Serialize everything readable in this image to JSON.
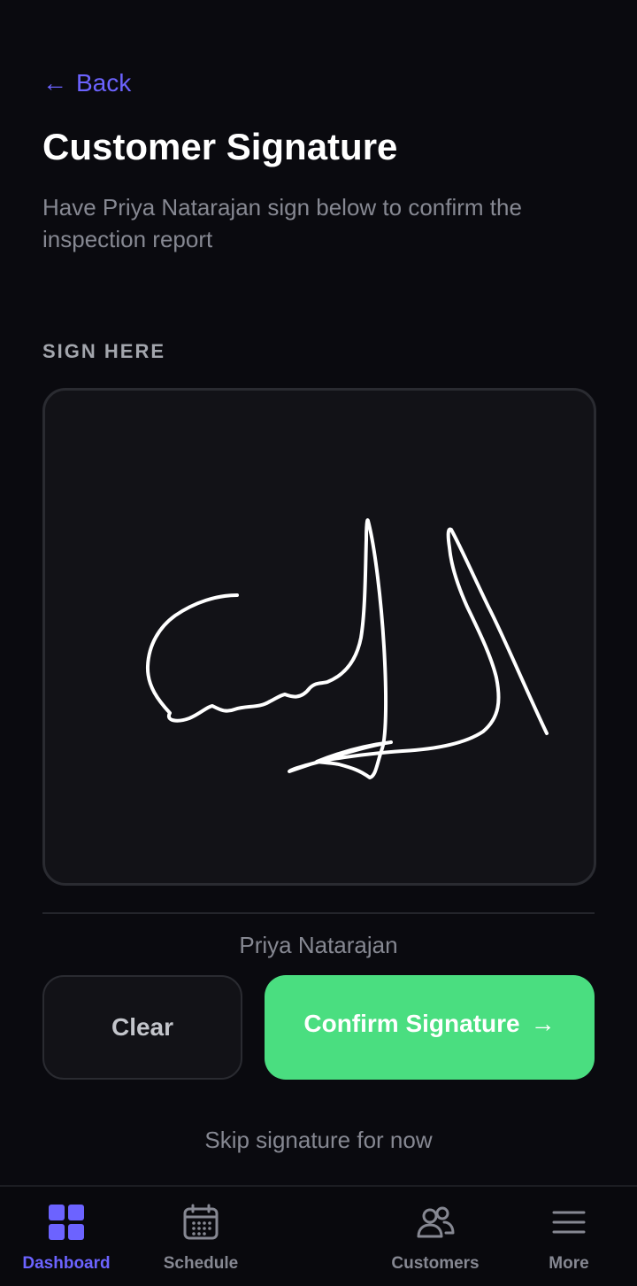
{
  "header": {
    "back_label": "Back",
    "back_icon": "arrow-left-icon",
    "title": "Customer Signature",
    "subtitle": "Have Priya Natarajan sign below to confirm the inspection report"
  },
  "signature": {
    "section_label": "SIGN HERE",
    "signer_name": "Priya Natarajan"
  },
  "actions": {
    "clear_label": "Clear",
    "confirm_label": "Confirm Signature",
    "confirm_icon": "arrow-right-icon",
    "skip_label": "Skip signature for now"
  },
  "nav": {
    "items": [
      {
        "label": "Dashboard",
        "icon": "grid-icon",
        "active": true
      },
      {
        "label": "Schedule",
        "icon": "calendar-icon",
        "active": false
      },
      {
        "label": "Customers",
        "icon": "users-icon",
        "active": false
      },
      {
        "label": "More",
        "icon": "menu-icon",
        "active": false
      }
    ]
  },
  "colors": {
    "background": "#0a0a0f",
    "accent": "#6c63ff",
    "confirm": "#4ade80",
    "muted_text": "#868892"
  }
}
